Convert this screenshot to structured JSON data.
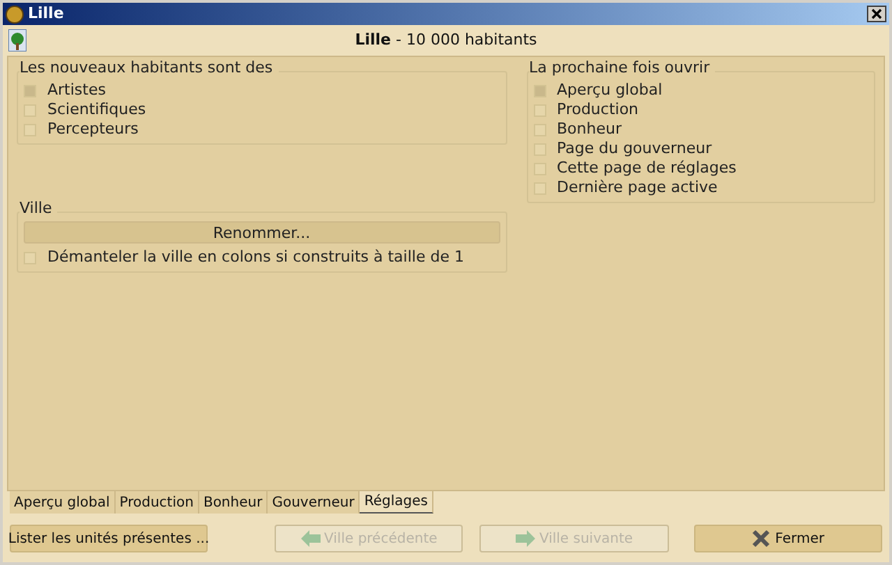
{
  "window": {
    "title": "Lille"
  },
  "header": {
    "text": "**Lille** - 10 000 habitants"
  },
  "citizens": {
    "title": "Les nouveaux habitants sont des",
    "options": [
      {
        "label": "Artistes",
        "selected": true
      },
      {
        "label": "Scientifiques",
        "selected": false
      },
      {
        "label": "Percepteurs",
        "selected": false
      }
    ]
  },
  "next_open": {
    "title": "La prochaine fois ouvrir",
    "options": [
      {
        "label": "Aperçu global",
        "selected": true
      },
      {
        "label": "Production",
        "selected": false
      },
      {
        "label": "Bonheur",
        "selected": false
      },
      {
        "label": "Page du gouverneur",
        "selected": false
      },
      {
        "label": "Cette page de réglages",
        "selected": false
      },
      {
        "label": "Dernière page active",
        "selected": false
      }
    ]
  },
  "city": {
    "title": "Ville",
    "rename_button": "Renommer...",
    "disband": {
      "label": "Démanteler la ville en colons si construits à taille de 1",
      "checked": false
    }
  },
  "tabs": [
    {
      "label": "Aperçu global",
      "selected": false
    },
    {
      "label": "Production",
      "selected": false
    },
    {
      "label": "Bonheur",
      "selected": false
    },
    {
      "label": "Gouverneur",
      "selected": false
    },
    {
      "label": "Réglages",
      "selected": true
    }
  ],
  "buttons": [
    {
      "label": "Lister les unités présentes ...",
      "kind": "plain",
      "disabled": false
    },
    {
      "label": "Ville précédente",
      "kind": "prev",
      "disabled": true
    },
    {
      "label": "Ville suivante",
      "kind": "next",
      "disabled": true
    },
    {
      "label": "Fermer",
      "kind": "close",
      "disabled": false
    }
  ]
}
